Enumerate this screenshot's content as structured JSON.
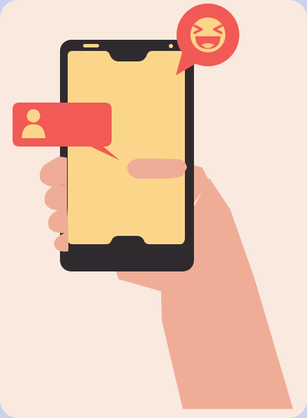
{
  "illustration": {
    "subject": "hand-holding-smartphone-with-chat-notifications",
    "icons": [
      "laughing-emoji-icon",
      "user-profile-icon"
    ],
    "colors": {
      "frame": "#c9d3ee",
      "background": "#f9e9df",
      "phone_body": "#2f2a2e",
      "screen": "#fbd68a",
      "skin": "#efad97",
      "skin_shadow": "#e49e88",
      "bubble_red": "#f25a55",
      "emoji_face": "#fbd68a",
      "emoji_mouth": "#f25a55"
    }
  }
}
